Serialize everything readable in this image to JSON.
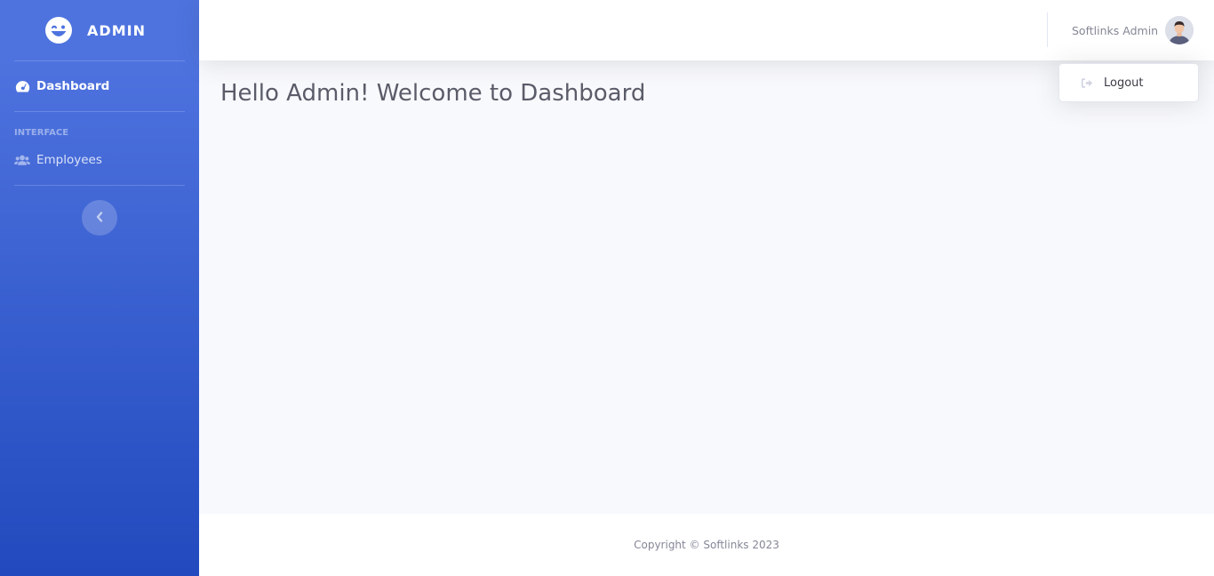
{
  "sidebar": {
    "brand_text": "ADMIN",
    "brand_icon": "laugh-wink-icon",
    "items": [
      {
        "label": "Dashboard",
        "icon": "tachometer-icon",
        "active": true
      },
      {
        "label": "Employees",
        "icon": "users-icon",
        "active": false
      }
    ],
    "heading": "Interface",
    "toggle_icon": "chevron-left-icon"
  },
  "topbar": {
    "user_name": "Softlinks Admin",
    "avatar_icon": "user-avatar"
  },
  "dropdown": {
    "items": [
      {
        "label": "Logout",
        "icon": "sign-out-icon"
      }
    ]
  },
  "main": {
    "title": "Hello Admin! Welcome to Dashboard"
  },
  "footer": {
    "copyright": "Copyright © Softlinks 2023"
  },
  "colors": {
    "sidebar_top": "#4e73df",
    "sidebar_bottom": "#224abe",
    "page_bg": "#f8f9fc",
    "title_text": "#5a5c69",
    "muted_text": "#858796"
  }
}
